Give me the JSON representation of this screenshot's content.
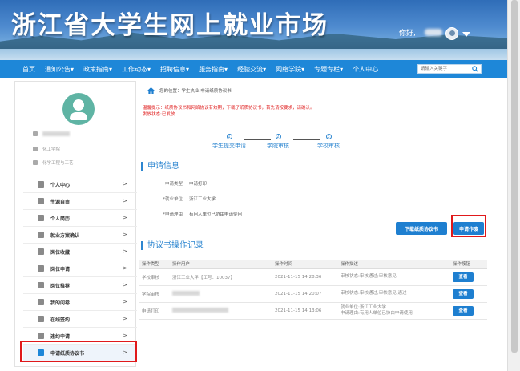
{
  "header": {
    "site_title": "浙江省大学生网上就业市场",
    "greeting": "你好,"
  },
  "nav": {
    "items": [
      "首页",
      "通知公告▾",
      "政策指南▾",
      "工作动态▾",
      "招聘信息▾",
      "服务指南▾",
      "经验交流▾",
      "网络学院▾",
      "专题专栏▾",
      "个人中心"
    ],
    "search_placeholder": "请输入关键字"
  },
  "sidebar": {
    "info": [
      "化工学院",
      "化学工程与工艺"
    ],
    "menu": [
      {
        "label": "个人中心"
      },
      {
        "label": "生源自审"
      },
      {
        "label": "个人简历"
      },
      {
        "label": "就业方案确认"
      },
      {
        "label": "岗位收藏"
      },
      {
        "label": "岗位申请"
      },
      {
        "label": "岗位推荐"
      },
      {
        "label": "我的问卷"
      },
      {
        "label": "在线签约"
      },
      {
        "label": "违约申请"
      },
      {
        "label": "申请纸质协议书"
      }
    ]
  },
  "main": {
    "breadcrumb": "您的位置：学生执业 申请纸质协议书",
    "warning_lines": [
      "温馨提示：纸质协议书和网络协议有效期，下载了纸质协议书，首先请按要求，请确认。",
      "发放状态:已发放"
    ],
    "steps": [
      "学生提交申请",
      "学院审核",
      "学校审核"
    ],
    "apply_section_title": "申请信息",
    "fields": [
      {
        "label": "申请类型",
        "value": "申请打印"
      },
      {
        "label": "*就业单位",
        "value": "浙江工业大学"
      },
      {
        "label": "*申请理由",
        "value": "有用人单位已协由申请使用"
      }
    ],
    "download_button": "下载纸质协议书",
    "cancel_button": "申请作废",
    "log_section_title": "协议书操作记录",
    "table": {
      "headers": [
        "操作类型",
        "操作用户",
        "操作时间",
        "操作描述",
        "操作按钮"
      ],
      "rows": [
        {
          "type": "学校审核",
          "user": "浙江工业大学【工号：10037】",
          "time": "2021-11-15 14:28:36",
          "desc": [
            "审核状态:审核通过;审核意见:"
          ],
          "action": "查看"
        },
        {
          "type": "学院审核",
          "user": "",
          "time": "2021-11-15 14:20:07",
          "desc": [
            "审核状态:审核通过;审核意见:通过"
          ],
          "action": "查看"
        },
        {
          "type": "申请打印",
          "user": "",
          "time": "2021-11-15 14:13:06",
          "desc": [
            "就业单位:浙江工业大学",
            "申请理由:有用人单位已协由申请使用"
          ],
          "action": "查看"
        }
      ]
    }
  },
  "colors": {
    "accent": "#1e87d8",
    "highlight": "#e0191b",
    "warning": "#e02020"
  }
}
